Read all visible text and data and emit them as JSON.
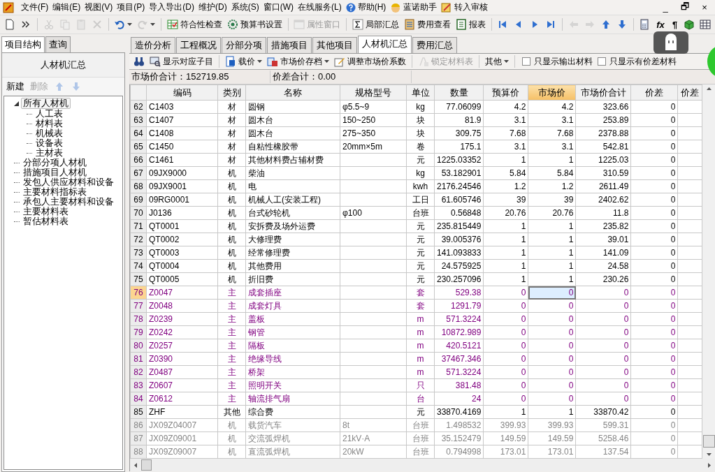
{
  "menu": [
    {
      "label": "文件(F)"
    },
    {
      "label": "编辑(E)"
    },
    {
      "label": "视图(V)"
    },
    {
      "label": "项目(P)"
    },
    {
      "label": "导入导出(D)"
    },
    {
      "label": "维护(D)"
    },
    {
      "label": "系统(S)"
    },
    {
      "label": "窗口(W)"
    },
    {
      "label": "在线服务(L)"
    },
    {
      "label": "帮助(H)",
      "kind": "help"
    },
    {
      "label": "蓝诺助手",
      "kind": "helper"
    },
    {
      "label": "转入审核",
      "kind": "audit"
    }
  ],
  "window_controls": [
    {
      "label": "_"
    },
    {
      "label": "🗗"
    },
    {
      "label": "×"
    }
  ],
  "toolbar": [
    {
      "kind": "new",
      "disabled": false
    },
    {
      "kind": "more",
      "disabled": false
    },
    {
      "kind": "separator"
    },
    {
      "kind": "cut",
      "disabled": true
    },
    {
      "kind": "copy",
      "disabled": true
    },
    {
      "kind": "paste",
      "disabled": true
    },
    {
      "kind": "delete",
      "disabled": true
    },
    {
      "kind": "separator"
    },
    {
      "kind": "undo",
      "disabled": false,
      "dropdown": true
    },
    {
      "kind": "redo",
      "disabled": true,
      "dropdown": true
    },
    {
      "kind": "separator"
    },
    {
      "kind": "check",
      "label": "符合性检查",
      "disabled": false
    },
    {
      "kind": "settings",
      "label": "预算书设置",
      "disabled": false
    },
    {
      "kind": "separator"
    },
    {
      "kind": "props",
      "label": "属性窗口",
      "disabled": true
    },
    {
      "kind": "separator"
    },
    {
      "kind": "sum",
      "label": "局部汇总",
      "disabled": false
    },
    {
      "kind": "cost",
      "label": "费用查看",
      "disabled": false
    },
    {
      "kind": "report",
      "label": "报表",
      "disabled": false
    },
    {
      "kind": "separator"
    },
    {
      "kind": "first",
      "disabled": false
    },
    {
      "kind": "prev",
      "disabled": false
    },
    {
      "kind": "next",
      "disabled": false
    },
    {
      "kind": "last",
      "disabled": false
    },
    {
      "kind": "separator"
    },
    {
      "kind": "back",
      "disabled": true
    },
    {
      "kind": "forward",
      "disabled": true
    },
    {
      "kind": "up",
      "disabled": false
    },
    {
      "kind": "down",
      "disabled": false
    },
    {
      "kind": "separator"
    },
    {
      "kind": "calc",
      "disabled": false
    },
    {
      "kind": "glyph",
      "label": "fx",
      "disabled": false
    },
    {
      "kind": "glyph",
      "label": "¶",
      "disabled": false
    },
    {
      "kind": "cube",
      "disabled": false
    },
    {
      "kind": "table",
      "disabled": false
    }
  ],
  "left_tabs": [
    {
      "label": "项目结构",
      "selected": true
    },
    {
      "label": "查询",
      "selected": false
    }
  ],
  "left_title": "人材机汇总",
  "left_actions": [
    {
      "kind": "text",
      "label": "新建",
      "disabled": false
    },
    {
      "kind": "text",
      "label": "删除",
      "disabled": true
    },
    {
      "kind": "up",
      "disabled": true
    },
    {
      "kind": "down",
      "disabled": true
    }
  ],
  "tree": [
    {
      "label": "所有人材机",
      "selected": true,
      "expanded": true,
      "children": [
        {
          "label": "人工表",
          "selected": false
        },
        {
          "label": "材料表",
          "selected": false
        },
        {
          "label": "机械表",
          "selected": false
        },
        {
          "label": "设备表",
          "selected": false
        },
        {
          "label": "主材表",
          "selected": false
        }
      ]
    },
    {
      "label": "分部分项人材机",
      "selected": false
    },
    {
      "label": "措施项目人材机",
      "selected": false
    },
    {
      "label": "发包人供应材料和设备",
      "selected": false
    },
    {
      "label": "主要材料指标表",
      "selected": false
    },
    {
      "label": "承包人主要材料和设备",
      "selected": false
    },
    {
      "label": "主要材料表",
      "selected": false
    },
    {
      "label": "暂估材料表",
      "selected": false
    }
  ],
  "tabs": [
    {
      "label": "造价分析",
      "selected": false
    },
    {
      "label": "工程概况",
      "selected": false
    },
    {
      "label": "分部分项",
      "selected": false
    },
    {
      "label": "措施项目",
      "selected": false
    },
    {
      "label": "其他项目",
      "selected": false
    },
    {
      "label": "人材机汇总",
      "selected": true
    },
    {
      "label": "费用汇总",
      "selected": false
    }
  ],
  "subtoolbar": [
    {
      "kind": "find",
      "disabled": false
    },
    {
      "kind": "show",
      "label": "显示对应子目",
      "disabled": false
    },
    {
      "kind": "separator"
    },
    {
      "kind": "load",
      "label": "载价",
      "disabled": false,
      "dropdown": true
    },
    {
      "kind": "archive",
      "label": "市场价存档",
      "disabled": false,
      "dropdown": true
    },
    {
      "kind": "adjust",
      "label": "调整市场价系数",
      "disabled": false
    },
    {
      "kind": "separator"
    },
    {
      "kind": "lock",
      "label": "锁定材料表",
      "disabled": true
    },
    {
      "kind": "separator"
    },
    {
      "kind": "plain",
      "label": "其他",
      "disabled": false,
      "dropdown": true
    },
    {
      "kind": "separator"
    },
    {
      "kind": "checkbox",
      "label": "只显示输出材料",
      "checked": false
    },
    {
      "kind": "checkbox",
      "label": "只显示有价差材料",
      "checked": false
    }
  ],
  "summary": [
    {
      "label": "市场价合计：152719.85"
    },
    {
      "label": "价差合计：0.00"
    }
  ],
  "columns": [
    {
      "label": "编码",
      "selected": false
    },
    {
      "label": "类别",
      "selected": false
    },
    {
      "label": "名称",
      "selected": false
    },
    {
      "label": "规格型号",
      "selected": false
    },
    {
      "label": "单位",
      "selected": false
    },
    {
      "label": "数量",
      "selected": false
    },
    {
      "label": "预算价",
      "selected": false
    },
    {
      "label": "市场价",
      "selected": true
    },
    {
      "label": "市场价合计",
      "selected": false
    },
    {
      "label": "价差",
      "selected": false
    },
    {
      "label": "价差",
      "selected": false
    }
  ],
  "rows": [
    {
      "no": "62",
      "code": "C1403",
      "type": "材",
      "name": "圆钢",
      "spec": "φ5.5~9",
      "unit": "kg",
      "qty": "77.06099",
      "budget": "4.2",
      "market": "4.2",
      "total": "323.66",
      "diff": "0",
      "kind": "normal",
      "selected": false
    },
    {
      "no": "63",
      "code": "C1407",
      "type": "材",
      "name": "圆木台",
      "spec": "150~250",
      "unit": "块",
      "qty": "81.9",
      "budget": "3.1",
      "market": "3.1",
      "total": "253.89",
      "diff": "0",
      "kind": "normal",
      "selected": false
    },
    {
      "no": "64",
      "code": "C1408",
      "type": "材",
      "name": "圆木台",
      "spec": "275~350",
      "unit": "块",
      "qty": "309.75",
      "budget": "7.68",
      "market": "7.68",
      "total": "2378.88",
      "diff": "0",
      "kind": "normal",
      "selected": false
    },
    {
      "no": "65",
      "code": "C1450",
      "type": "材",
      "name": "自粘性橡胶带",
      "spec": "20mm×5m",
      "unit": "卷",
      "qty": "175.1",
      "budget": "3.1",
      "market": "3.1",
      "total": "542.81",
      "diff": "0",
      "kind": "normal",
      "selected": false
    },
    {
      "no": "66",
      "code": "C1461",
      "type": "材",
      "name": "其他材料费占辅材费",
      "unit": "元",
      "qty": "1225.03352",
      "budget": "1",
      "market": "1",
      "total": "1225.03",
      "diff": "0",
      "kind": "normal",
      "selected": false
    },
    {
      "no": "67",
      "code": "09JX9000",
      "type": "机",
      "name": "柴油",
      "unit": "kg",
      "qty": "53.182901",
      "budget": "5.84",
      "market": "5.84",
      "total": "310.59",
      "diff": "0",
      "kind": "normal",
      "selected": false
    },
    {
      "no": "68",
      "code": "09JX9001",
      "type": "机",
      "name": "电",
      "unit": "kwh",
      "qty": "2176.24546",
      "budget": "1.2",
      "market": "1.2",
      "total": "2611.49",
      "diff": "0",
      "kind": "normal",
      "selected": false
    },
    {
      "no": "69",
      "code": "09RG0001",
      "type": "机",
      "name": "机械人工(安装工程)",
      "unit": "工日",
      "qty": "61.605746",
      "budget": "39",
      "market": "39",
      "total": "2402.62",
      "diff": "0",
      "kind": "normal",
      "selected": false
    },
    {
      "no": "70",
      "code": "J0136",
      "type": "机",
      "name": "台式砂轮机",
      "spec": "φ100",
      "unit": "台班",
      "qty": "0.56848",
      "budget": "20.76",
      "market": "20.76",
      "total": "11.8",
      "diff": "0",
      "kind": "normal",
      "selected": false
    },
    {
      "no": "71",
      "code": "QT0001",
      "type": "机",
      "name": "安拆费及场外运费",
      "unit": "元",
      "qty": "235.815449",
      "budget": "1",
      "market": "1",
      "total": "235.82",
      "diff": "0",
      "kind": "normal",
      "selected": false
    },
    {
      "no": "72",
      "code": "QT0002",
      "type": "机",
      "name": "大修理费",
      "unit": "元",
      "qty": "39.005376",
      "budget": "1",
      "market": "1",
      "total": "39.01",
      "diff": "0",
      "kind": "normal",
      "selected": false
    },
    {
      "no": "73",
      "code": "QT0003",
      "type": "机",
      "name": "经常修理费",
      "unit": "元",
      "qty": "141.093833",
      "budget": "1",
      "market": "1",
      "total": "141.09",
      "diff": "0",
      "kind": "normal",
      "selected": false
    },
    {
      "no": "74",
      "code": "QT0004",
      "type": "机",
      "name": "其他费用",
      "unit": "元",
      "qty": "24.575925",
      "budget": "1",
      "market": "1",
      "total": "24.58",
      "diff": "0",
      "kind": "normal",
      "selected": false
    },
    {
      "no": "75",
      "code": "QT0005",
      "type": "机",
      "name": "折旧费",
      "unit": "元",
      "qty": "230.257096",
      "budget": "1",
      "market": "1",
      "total": "230.26",
      "diff": "0",
      "kind": "normal",
      "selected": false
    },
    {
      "no": "76",
      "code": "Z0047",
      "type": "主",
      "name": "成套插座",
      "unit": "套",
      "qty": "529.38",
      "budget": "0",
      "market": "0",
      "total": "0",
      "diff": "0",
      "kind": "main",
      "selected": true
    },
    {
      "no": "77",
      "code": "Z0048",
      "type": "主",
      "name": "成套灯具",
      "unit": "套",
      "qty": "1291.79",
      "budget": "0",
      "market": "0",
      "total": "0",
      "diff": "0",
      "kind": "main",
      "selected": false
    },
    {
      "no": "78",
      "code": "Z0239",
      "type": "主",
      "name": "盖板",
      "unit": "m",
      "qty": "571.3224",
      "budget": "0",
      "market": "0",
      "total": "0",
      "diff": "0",
      "kind": "main",
      "selected": false
    },
    {
      "no": "79",
      "code": "Z0242",
      "type": "主",
      "name": "钢管",
      "unit": "m",
      "qty": "10872.989",
      "budget": "0",
      "market": "0",
      "total": "0",
      "diff": "0",
      "kind": "main",
      "selected": false
    },
    {
      "no": "80",
      "code": "Z0257",
      "type": "主",
      "name": "隔板",
      "unit": "m",
      "qty": "420.5121",
      "budget": "0",
      "market": "0",
      "total": "0",
      "diff": "0",
      "kind": "main",
      "selected": false
    },
    {
      "no": "81",
      "code": "Z0390",
      "type": "主",
      "name": "绝缘导线",
      "unit": "m",
      "qty": "37467.346",
      "budget": "0",
      "market": "0",
      "total": "0",
      "diff": "0",
      "kind": "main",
      "selected": false
    },
    {
      "no": "82",
      "code": "Z0487",
      "type": "主",
      "name": "桥架",
      "unit": "m",
      "qty": "571.3224",
      "budget": "0",
      "market": "0",
      "total": "0",
      "diff": "0",
      "kind": "main",
      "selected": false
    },
    {
      "no": "83",
      "code": "Z0607",
      "type": "主",
      "name": "照明开关",
      "unit": "只",
      "qty": "381.48",
      "budget": "0",
      "market": "0",
      "total": "0",
      "diff": "0",
      "kind": "main",
      "selected": false
    },
    {
      "no": "84",
      "code": "Z0612",
      "type": "主",
      "name": "轴流排气扇",
      "unit": "台",
      "qty": "24",
      "budget": "0",
      "market": "0",
      "total": "0",
      "diff": "0",
      "kind": "main",
      "selected": false
    },
    {
      "no": "85",
      "code": "ZHF",
      "type": "其他",
      "name": "综合费",
      "unit": "元",
      "qty": "33870.4169",
      "budget": "1",
      "market": "1",
      "total": "33870.42",
      "diff": "0",
      "kind": "normal",
      "selected": false
    },
    {
      "no": "86",
      "code": "JX09Z04007",
      "type": "机",
      "name": "载货汽车",
      "spec": "8t",
      "unit": "台班",
      "qty": "1.498532",
      "budget": "399.93",
      "market": "399.93",
      "total": "599.31",
      "diff": "0",
      "kind": "dim",
      "selected": false
    },
    {
      "no": "87",
      "code": "JX09Z09001",
      "type": "机",
      "name": "交流弧焊机",
      "spec": "21kV·A",
      "unit": "台班",
      "qty": "35.152479",
      "budget": "149.59",
      "market": "149.59",
      "total": "5258.46",
      "diff": "0",
      "kind": "dim",
      "selected": false
    },
    {
      "no": "88",
      "code": "JX09Z09007",
      "type": "机",
      "name": "直流弧焊机",
      "spec": "20kW",
      "unit": "台班",
      "qty": "0.794998",
      "budget": "173.01",
      "market": "173.01",
      "total": "137.54",
      "diff": "0",
      "kind": "dim",
      "selected": false
    }
  ]
}
